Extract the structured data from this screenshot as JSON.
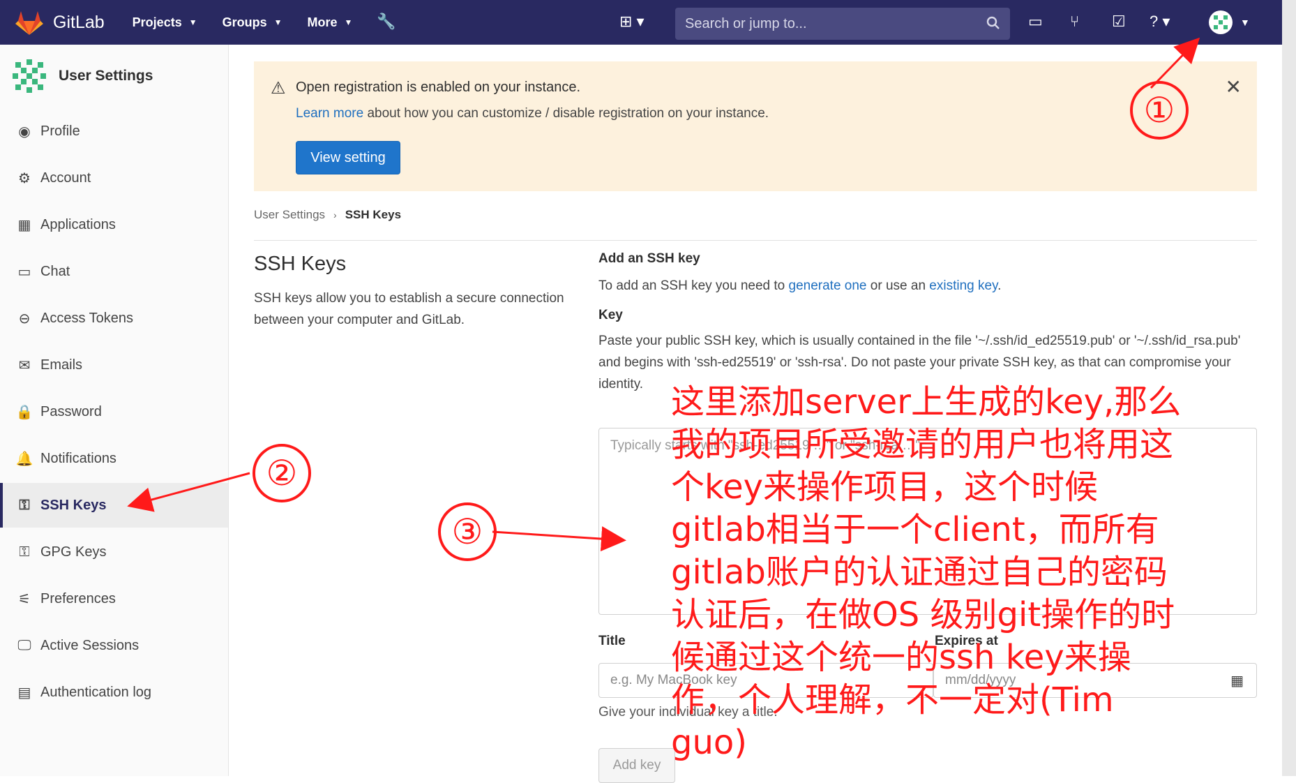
{
  "topbar": {
    "brand": "GitLab",
    "nav": [
      "Projects",
      "Groups",
      "More"
    ],
    "search_placeholder": "Search or jump to..."
  },
  "sidebar": {
    "title": "User Settings",
    "items": [
      {
        "label": "Profile",
        "icon": "profile-icon"
      },
      {
        "label": "Account",
        "icon": "account-icon"
      },
      {
        "label": "Applications",
        "icon": "applications-icon"
      },
      {
        "label": "Chat",
        "icon": "chat-icon"
      },
      {
        "label": "Access Tokens",
        "icon": "token-icon"
      },
      {
        "label": "Emails",
        "icon": "mail-icon"
      },
      {
        "label": "Password",
        "icon": "lock-icon"
      },
      {
        "label": "Notifications",
        "icon": "bell-icon"
      },
      {
        "label": "SSH Keys",
        "icon": "key-icon"
      },
      {
        "label": "GPG Keys",
        "icon": "key-icon"
      },
      {
        "label": "Preferences",
        "icon": "preferences-icon"
      },
      {
        "label": "Active Sessions",
        "icon": "monitor-icon"
      },
      {
        "label": "Authentication log",
        "icon": "log-icon"
      }
    ]
  },
  "banner": {
    "title": "Open registration is enabled on your instance.",
    "link_text": "Learn more",
    "desc": " about how you can customize / disable registration on your instance.",
    "button": "View setting"
  },
  "breadcrumb": {
    "parent": "User Settings",
    "current": "SSH Keys"
  },
  "left": {
    "title": "SSH Keys",
    "desc": "SSH keys allow you to establish a secure connection between your computer and GitLab."
  },
  "form": {
    "heading": "Add an SSH key",
    "intro_a": "To add an SSH key you need to ",
    "intro_link1": "generate one",
    "intro_b": " or use an ",
    "intro_link2": "existing key",
    "intro_c": ".",
    "key_label": "Key",
    "key_help": "Paste your public SSH key, which is usually contained in the file '~/.ssh/id_ed25519.pub' or '~/.ssh/id_rsa.pub' and begins with 'ssh-ed25519' or 'ssh-rsa'. Do not paste your private SSH key, as that can compromise your identity.",
    "key_placeholder": "Typically starts with \"ssh-ed25519 …\" or \"ssh-rsa …\"",
    "title_label": "Title",
    "title_placeholder": "e.g. My MacBook key",
    "expires_label": "Expires at",
    "expires_placeholder": "mm/dd/yyyy",
    "title_help": "Give your individual key a title.",
    "add_button": "Add key"
  },
  "annotations": {
    "one": "①",
    "two": "②",
    "three": "③",
    "text": "这里添加server上生成的key,那么我的项目所受邀请的用户也将用这个key来操作项目，这个时候gitlab相当于一个client，而所有gitlab账户的认证通过自己的密码认证后，在做OS 级别git操作的时候通过这个统一的ssh key来操作，个人理解，不一定对(Tim guo)",
    "color": "#ff1a1a"
  }
}
